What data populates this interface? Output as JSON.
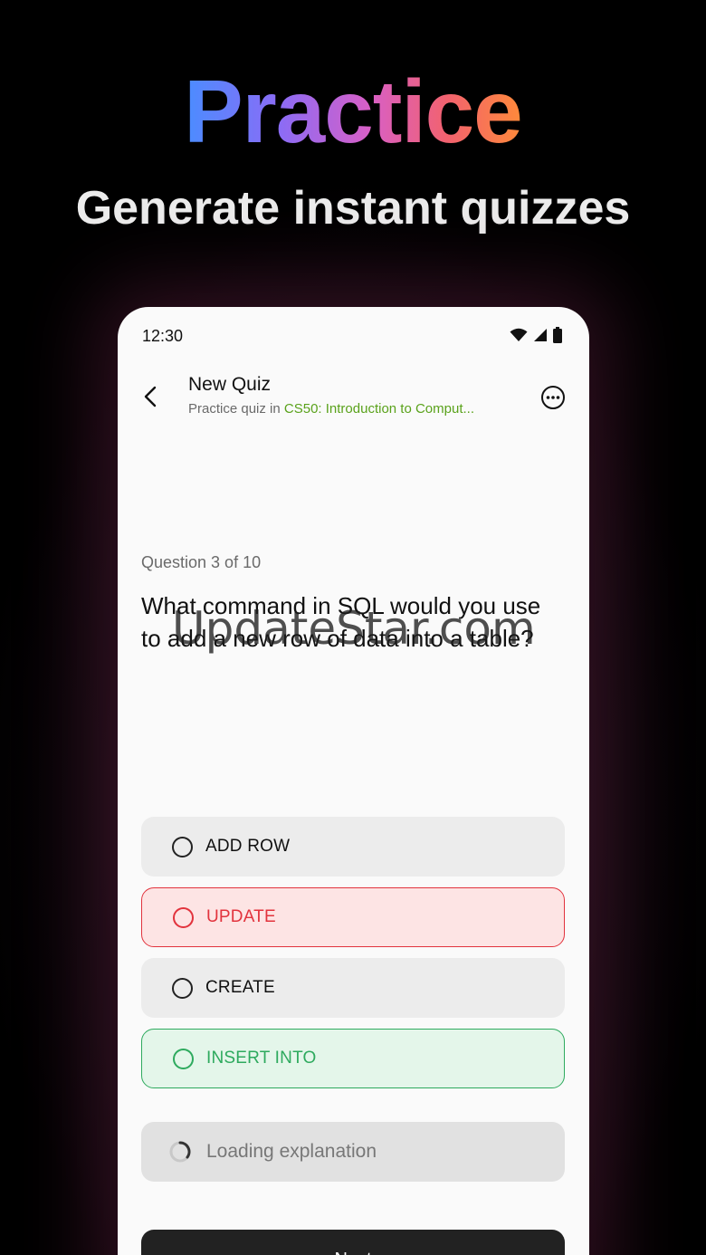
{
  "hero": {
    "title": "Practice",
    "subtitle": "Generate instant quizzes"
  },
  "status_bar": {
    "time": "12:30"
  },
  "header": {
    "title": "New Quiz",
    "subtitle_prefix": "Practice quiz in ",
    "course": "CS50: Introduction to Comput..."
  },
  "question": {
    "counter": "Question 3 of 10",
    "text": "What command in SQL would you use to add a new row of data into a table?"
  },
  "options": [
    {
      "label": "ADD ROW",
      "state": "neutral"
    },
    {
      "label": "UPDATE",
      "state": "wrong"
    },
    {
      "label": "CREATE",
      "state": "neutral"
    },
    {
      "label": "INSERT INTO",
      "state": "correct"
    }
  ],
  "explanation": {
    "label": "Loading explanation"
  },
  "next_button": {
    "label": "Next"
  },
  "watermark": "UpdateStar.com",
  "colors": {
    "wrong": "#e2333d",
    "correct": "#2eaa5e",
    "course_link": "#5aa21b"
  }
}
